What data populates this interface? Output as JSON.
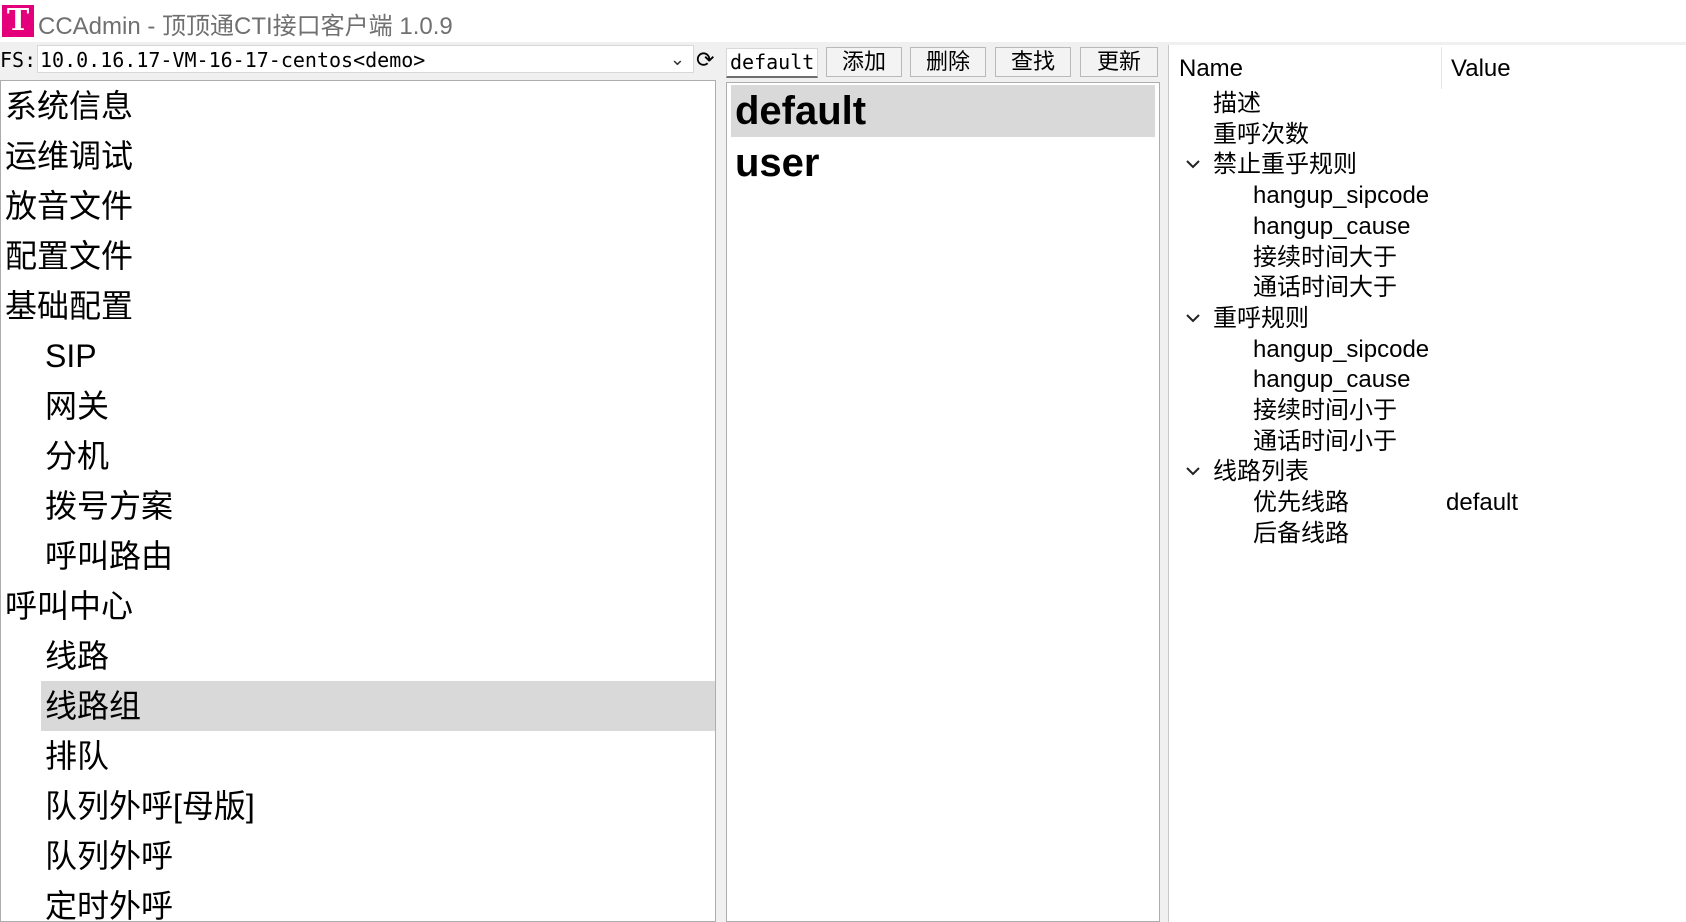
{
  "window": {
    "logo_letter": "T",
    "title": "CCAdmin - 顶顶通CTI接口客户端 1.0.9"
  },
  "server": {
    "label": "FS:",
    "selected": "10.0.16.17-VM-16-17-centos<demo>"
  },
  "nav": {
    "items": [
      {
        "label": "系统信息",
        "level": 0
      },
      {
        "label": "运维调试",
        "level": 0
      },
      {
        "label": "放音文件",
        "level": 0
      },
      {
        "label": "配置文件",
        "level": 0
      },
      {
        "label": "基础配置",
        "level": 0
      },
      {
        "label": "SIP",
        "level": 1
      },
      {
        "label": "网关",
        "level": 1
      },
      {
        "label": "分机",
        "level": 1
      },
      {
        "label": "拨号方案",
        "level": 1
      },
      {
        "label": "呼叫路由",
        "level": 1
      },
      {
        "label": "呼叫中心",
        "level": 0
      },
      {
        "label": "线路",
        "level": 1
      },
      {
        "label": "线路组",
        "level": 1,
        "selected": true
      },
      {
        "label": "排队",
        "level": 1
      },
      {
        "label": "队列外呼[母版]",
        "level": 1
      },
      {
        "label": "队列外呼",
        "level": 1
      },
      {
        "label": "定时外呼",
        "level": 1
      }
    ]
  },
  "toolbar": {
    "name_value": "default",
    "add_label": "添加",
    "delete_label": "删除",
    "find_label": "查找",
    "update_label": "更新"
  },
  "list": {
    "items": [
      {
        "label": "default",
        "selected": true
      },
      {
        "label": "user",
        "selected": false
      }
    ]
  },
  "properties": {
    "col_name": "Name",
    "col_value": "Value",
    "rows": [
      {
        "name": "描述",
        "value": "",
        "level": 0,
        "expandable": false
      },
      {
        "name": "重呼次数",
        "value": "",
        "level": 0,
        "expandable": false
      },
      {
        "name": "禁止重乎规则",
        "value": "",
        "level": 0,
        "expandable": true
      },
      {
        "name": "hangup_sipcode",
        "value": "",
        "level": 1,
        "expandable": false
      },
      {
        "name": "hangup_cause",
        "value": "",
        "level": 1,
        "expandable": false
      },
      {
        "name": "接续时间大于",
        "value": "",
        "level": 1,
        "expandable": false
      },
      {
        "name": "通话时间大于",
        "value": "",
        "level": 1,
        "expandable": false
      },
      {
        "name": "重呼规则",
        "value": "",
        "level": 0,
        "expandable": true
      },
      {
        "name": "hangup_sipcode",
        "value": "",
        "level": 1,
        "expandable": false
      },
      {
        "name": "hangup_cause",
        "value": "",
        "level": 1,
        "expandable": false
      },
      {
        "name": "接续时间小于",
        "value": "",
        "level": 1,
        "expandable": false
      },
      {
        "name": "通话时间小于",
        "value": "",
        "level": 1,
        "expandable": false
      },
      {
        "name": "线路列表",
        "value": "",
        "level": 0,
        "expandable": true
      },
      {
        "name": "优先线路",
        "value": "default",
        "level": 1,
        "expandable": false
      },
      {
        "name": "后备线路",
        "value": "",
        "level": 1,
        "expandable": false
      }
    ]
  }
}
